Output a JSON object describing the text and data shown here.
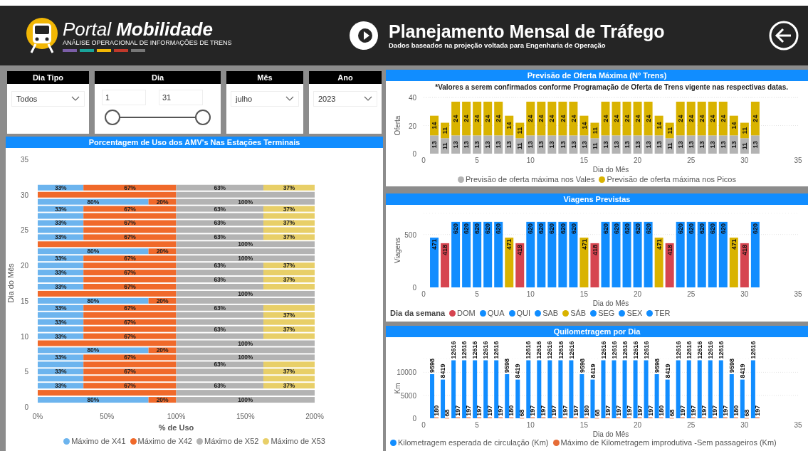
{
  "header": {
    "brand": "Portal **Mobilidade**",
    "tagline": "ANÁLISE OPERACIONAL DE INFORMAÇÕES DE TRENS",
    "title": "Planejamento Mensal de Tráfego",
    "subtitle": "Dados baseados na projeção voltada para Engenharia de Operação"
  },
  "filters": [
    {
      "kind": "dropdown",
      "label": "Dia Tipo",
      "value": "Todos"
    },
    {
      "kind": "range",
      "label": "Dia",
      "from": "1",
      "to": "31",
      "level": 1
    },
    {
      "kind": "dropdown",
      "label": "Mês",
      "value": "julho"
    },
    {
      "kind": "dropdown",
      "label": "Ano",
      "value": "2023"
    }
  ],
  "usage_panel": {
    "title": "Porcentagem de Uso dos AMV's Nas Estações Terminais",
    "chart_data": {
      "type": "bar",
      "orientation": "horizontal",
      "stacked": true,
      "xlabel": "% de Uso",
      "ylabel": "Dia do Mês",
      "xlim": [
        0,
        200
      ],
      "ylim": [
        0,
        35
      ],
      "xticks": [
        {
          "value": 0,
          "label": "0%"
        },
        {
          "value": 50,
          "label": "50%"
        },
        {
          "value": 100,
          "label": "100%"
        },
        {
          "value": 150,
          "label": "150%"
        },
        {
          "value": 200,
          "label": "200%"
        }
      ],
      "yticks": [
        0,
        5,
        10,
        15,
        20,
        25,
        30,
        35
      ],
      "x": [
        1,
        2,
        3,
        4,
        5,
        6,
        7,
        8,
        9,
        10,
        11,
        12,
        13,
        14,
        15,
        16,
        17,
        18,
        19,
        20,
        21,
        22,
        23,
        24,
        25,
        26,
        27,
        28,
        29,
        30,
        31
      ],
      "series": [
        {
          "name": "Máximo de X41",
          "color": "#6cb4ee",
          "values": [
            80,
            0,
            33,
            33,
            33,
            33,
            33,
            80,
            0,
            33,
            33,
            33,
            33,
            33,
            80,
            0,
            33,
            33,
            33,
            33,
            33,
            80,
            0,
            33,
            33,
            33,
            33,
            33,
            80,
            0,
            33
          ]
        },
        {
          "name": "Máximo de X42",
          "color": "#f0692a",
          "values": [
            20,
            100,
            67,
            67,
            67,
            67,
            67,
            20,
            100,
            67,
            67,
            67,
            67,
            67,
            20,
            100,
            67,
            67,
            67,
            67,
            67,
            20,
            100,
            67,
            67,
            67,
            67,
            67,
            20,
            100,
            67
          ]
        },
        {
          "name": "Máximo de X52",
          "color": "#b3b3b3",
          "values": [
            100,
            100,
            63,
            63,
            63,
            63,
            100,
            100,
            100,
            63,
            63,
            63,
            63,
            63,
            100,
            100,
            63,
            63,
            63,
            63,
            100,
            100,
            100,
            63,
            63,
            63,
            63,
            63,
            100,
            100,
            63
          ]
        },
        {
          "name": "Máximo de X53",
          "color": "#e8cf68",
          "values": [
            0,
            0,
            37,
            37,
            37,
            37,
            0,
            0,
            0,
            37,
            37,
            37,
            37,
            37,
            0,
            0,
            37,
            37,
            37,
            37,
            0,
            0,
            0,
            37,
            37,
            37,
            37,
            37,
            0,
            0,
            37
          ]
        }
      ],
      "value_labels": [
        [
          "80%",
          null,
          "33%",
          null,
          "33%",
          null,
          "33%",
          "80%",
          null,
          "33%",
          null,
          "33%",
          null,
          "33%",
          "80%",
          null,
          "33%",
          null,
          "33%",
          null,
          "33%",
          "80%",
          null,
          "33%",
          null,
          "33%",
          null,
          "33%",
          "80%",
          null,
          "33%"
        ],
        [
          "20%",
          null,
          "67%",
          null,
          "67%",
          null,
          "67%",
          "20%",
          null,
          "67%",
          null,
          "67%",
          null,
          "67%",
          "20%",
          null,
          "67%",
          null,
          "67%",
          null,
          "67%",
          "20%",
          null,
          "67%",
          null,
          "67%",
          null,
          "67%",
          "20%",
          null,
          "67%"
        ],
        [
          "100%",
          null,
          "63%",
          null,
          null,
          "63%",
          "100%",
          null,
          "100%",
          null,
          "63%",
          null,
          null,
          "63%",
          null,
          "100%",
          null,
          "63%",
          null,
          "63%",
          "100%",
          null,
          "100%",
          "63%",
          null,
          "63%",
          null,
          "63%",
          "100%",
          null,
          "63%"
        ],
        [
          null,
          null,
          "37%",
          null,
          "37%",
          null,
          null,
          null,
          null,
          null,
          "37%",
          null,
          "37%",
          null,
          null,
          null,
          null,
          "37%",
          null,
          "37%",
          null,
          null,
          null,
          "37%",
          null,
          "37%",
          null,
          "37%",
          null,
          null,
          "37%"
        ]
      ]
    }
  },
  "offer_panel": {
    "title": "Previsão de Oferta Máxima (N° Trens)",
    "note": "*Valores a serem confirmados conforme Programação de Oferta de Trens vigente nas respectivas datas.",
    "chart_data": {
      "type": "bar",
      "stacked": true,
      "data_labels": true,
      "xlabel": "Dia do Mês",
      "ylabel": "Oferta",
      "xlim": [
        0,
        35
      ],
      "ylim": [
        0,
        40
      ],
      "xticks": [
        0,
        5,
        10,
        15,
        20,
        25,
        30,
        35
      ],
      "yticks": [
        0,
        20,
        40
      ],
      "x": [
        1,
        2,
        3,
        4,
        5,
        6,
        7,
        8,
        9,
        10,
        11,
        12,
        13,
        14,
        15,
        16,
        17,
        18,
        19,
        20,
        21,
        22,
        23,
        24,
        25,
        26,
        27,
        28,
        29,
        30,
        31
      ],
      "series": [
        {
          "name": "Previsão de oferta máxima nos Vales",
          "color": "#b3b3b3",
          "values": [
            13,
            11,
            13,
            13,
            13,
            13,
            13,
            13,
            11,
            13,
            13,
            13,
            13,
            13,
            13,
            11,
            13,
            13,
            13,
            13,
            13,
            13,
            11,
            13,
            13,
            13,
            13,
            13,
            13,
            11,
            13
          ]
        },
        {
          "name": "Previsão de oferta máxima nos Picos",
          "color": "#d9b300",
          "values": [
            14,
            11,
            24,
            24,
            24,
            24,
            24,
            14,
            11,
            24,
            24,
            24,
            24,
            24,
            14,
            11,
            24,
            24,
            24,
            24,
            24,
            14,
            11,
            24,
            24,
            24,
            24,
            24,
            14,
            11,
            24
          ]
        }
      ]
    }
  },
  "trips_panel": {
    "title": "Viagens Previstas",
    "legend_title": "Dia da semana",
    "chart_data": {
      "type": "bar",
      "data_labels": true,
      "xlabel": "Dia do Mês",
      "ylabel": "Viagens",
      "xlim": [
        0,
        35
      ],
      "ylim": [
        0,
        700
      ],
      "xticks": [
        0,
        5,
        10,
        15,
        20,
        25,
        30,
        35
      ],
      "yticks": [
        0,
        500
      ],
      "x": [
        1,
        2,
        3,
        4,
        5,
        6,
        7,
        8,
        9,
        10,
        11,
        12,
        13,
        14,
        15,
        16,
        17,
        18,
        19,
        20,
        21,
        22,
        23,
        24,
        25,
        26,
        27,
        28,
        29,
        30,
        31
      ],
      "series": [
        {
          "name": "DOM",
          "color": "#d64550",
          "values": [
            null,
            418,
            null,
            null,
            null,
            null,
            null,
            null,
            418,
            null,
            null,
            null,
            null,
            null,
            null,
            418,
            null,
            null,
            null,
            null,
            null,
            null,
            418,
            null,
            null,
            null,
            null,
            null,
            null,
            418,
            null
          ]
        },
        {
          "name": "QUA",
          "color": "#118dff",
          "values": [
            null,
            null,
            null,
            null,
            620,
            null,
            null,
            null,
            null,
            null,
            null,
            620,
            null,
            null,
            null,
            null,
            null,
            null,
            620,
            null,
            null,
            null,
            null,
            null,
            null,
            620,
            null,
            null,
            null,
            null,
            null
          ]
        },
        {
          "name": "QUI",
          "color": "#118dff",
          "values": [
            null,
            null,
            null,
            null,
            null,
            620,
            null,
            null,
            null,
            null,
            null,
            null,
            620,
            null,
            null,
            null,
            null,
            null,
            null,
            620,
            null,
            null,
            null,
            null,
            null,
            null,
            620,
            null,
            null,
            null,
            null
          ]
        },
        {
          "name": "SAB",
          "color": "#118dff",
          "values": [
            471,
            null,
            null,
            null,
            null,
            null,
            null,
            null,
            null,
            null,
            null,
            null,
            null,
            null,
            null,
            null,
            null,
            null,
            null,
            null,
            null,
            null,
            null,
            null,
            null,
            null,
            null,
            null,
            null,
            null,
            null
          ]
        },
        {
          "name": "SÁB",
          "color": "#d9b300",
          "values": [
            null,
            null,
            null,
            null,
            null,
            null,
            null,
            471,
            null,
            null,
            null,
            null,
            null,
            null,
            471,
            null,
            null,
            null,
            null,
            null,
            null,
            471,
            null,
            null,
            null,
            null,
            null,
            null,
            471,
            null,
            null
          ]
        },
        {
          "name": "SEG",
          "color": "#118dff",
          "values": [
            null,
            null,
            620,
            null,
            null,
            null,
            null,
            null,
            null,
            620,
            null,
            null,
            null,
            null,
            null,
            null,
            620,
            null,
            null,
            null,
            null,
            null,
            null,
            620,
            null,
            null,
            null,
            null,
            null,
            null,
            620
          ]
        },
        {
          "name": "SEX",
          "color": "#118dff",
          "values": [
            null,
            null,
            null,
            null,
            null,
            null,
            620,
            null,
            null,
            null,
            null,
            null,
            null,
            620,
            null,
            null,
            null,
            null,
            null,
            null,
            620,
            null,
            null,
            null,
            null,
            null,
            null,
            620,
            null,
            null,
            null
          ]
        },
        {
          "name": "TER",
          "color": "#118dff",
          "values": [
            null,
            null,
            null,
            620,
            null,
            null,
            null,
            null,
            null,
            null,
            620,
            null,
            null,
            null,
            null,
            null,
            null,
            620,
            null,
            null,
            null,
            null,
            null,
            null,
            620,
            null,
            null,
            null,
            null,
            null,
            null
          ]
        }
      ]
    }
  },
  "km_panel": {
    "title": "Quilometragem por Dia",
    "chart_data": {
      "type": "bar",
      "stacked": false,
      "data_labels": true,
      "xlabel": "Dia do Mês",
      "ylabel": "Km",
      "xlim": [
        0,
        35
      ],
      "ylim": [
        0,
        13000
      ],
      "xticks": [
        0,
        5,
        10,
        15,
        20,
        25,
        30,
        35
      ],
      "yticks": [
        0,
        5000,
        10000
      ],
      "x": [
        1,
        2,
        3,
        4,
        5,
        6,
        7,
        8,
        9,
        10,
        11,
        12,
        13,
        14,
        15,
        16,
        17,
        18,
        19,
        20,
        21,
        22,
        23,
        24,
        25,
        26,
        27,
        28,
        29,
        30,
        31
      ],
      "series": [
        {
          "name": "Kilometragem esperada de circulação (Km)",
          "color": "#118dff",
          "values": [
            9598,
            8419,
            12616,
            12616,
            12616,
            12616,
            12616,
            9598,
            8419,
            12616,
            12616,
            12616,
            12616,
            12616,
            9598,
            8419,
            12616,
            12616,
            12616,
            12616,
            12616,
            9598,
            8419,
            12616,
            12616,
            12616,
            12616,
            12616,
            9598,
            8419,
            12616
          ]
        },
        {
          "name": "Máximo de Kilometragem improdutiva -Sem passageiros (Km)",
          "color": "#e66c37",
          "values": [
            180,
            68,
            197,
            197,
            197,
            197,
            197,
            180,
            68,
            197,
            197,
            197,
            197,
            197,
            180,
            68,
            197,
            197,
            197,
            197,
            197,
            180,
            68,
            197,
            197,
            197,
            197,
            197,
            180,
            68,
            197
          ]
        }
      ]
    }
  }
}
